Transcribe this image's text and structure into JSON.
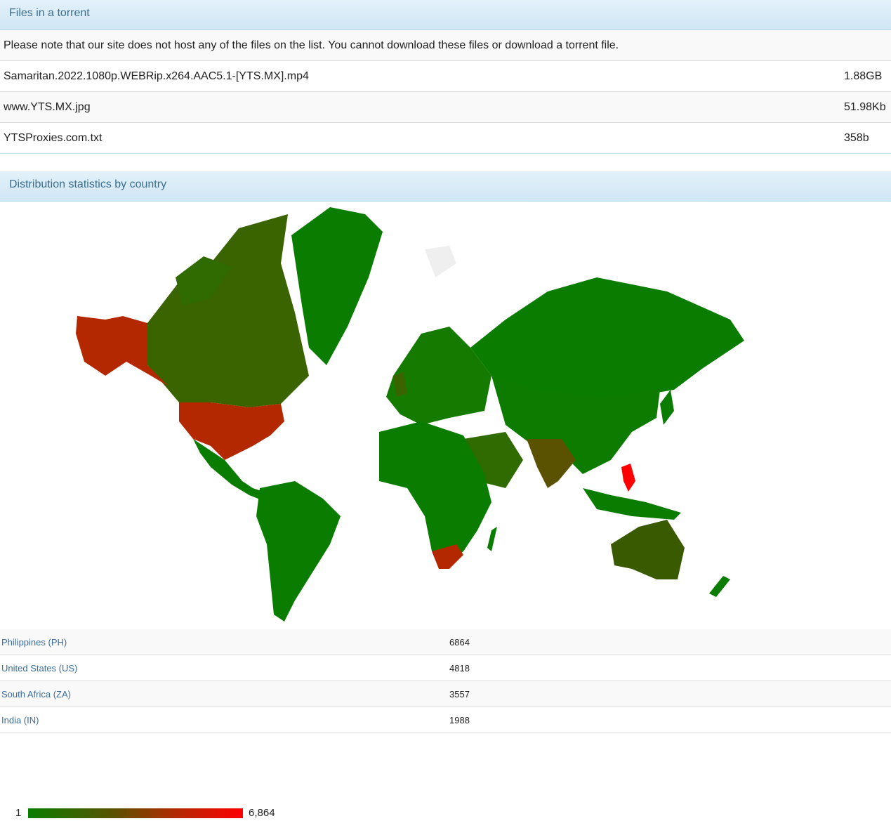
{
  "files_section": {
    "title": "Files in a torrent",
    "note": "Please note that our site does not host any of the files on the list. You cannot download these files or download a torrent file.",
    "files": [
      {
        "name": "Samaritan.2022.1080p.WEBRip.x264.AAC5.1-[YTS.MX].mp4",
        "size": "1.88GB"
      },
      {
        "name": "www.YTS.MX.jpg",
        "size": "51.98Kb"
      },
      {
        "name": "YTSProxies.com.txt",
        "size": "358b"
      }
    ]
  },
  "distribution_section": {
    "title": "Distribution statistics by country",
    "legend": {
      "min": "1",
      "max": "6,864"
    },
    "colors": {
      "low": "#0a7d00",
      "mid": "#5a5200",
      "high": "#b42800",
      "max": "#ff0000",
      "nodata": "#efefef"
    },
    "countries": [
      {
        "name": "Philippines (PH)",
        "value": "6864"
      },
      {
        "name": "United States (US)",
        "value": "4818"
      },
      {
        "name": "South Africa (ZA)",
        "value": "3557"
      },
      {
        "name": "India (IN)",
        "value": "1988"
      }
    ]
  }
}
